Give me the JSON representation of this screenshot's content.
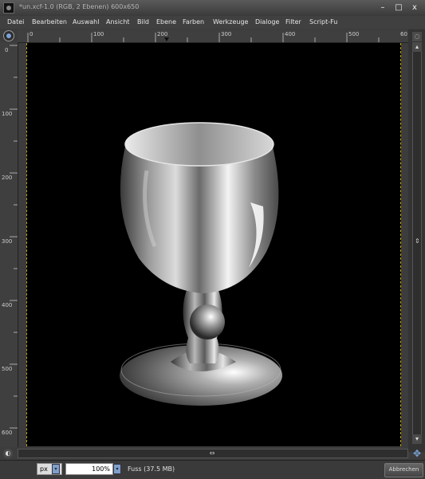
{
  "window": {
    "title": "*un.xcf-1.0 (RGB, 2 Ebenen) 600x650",
    "minimize": "–",
    "maximize": "□",
    "close": "x"
  },
  "menu": [
    "Datei",
    "Bearbeiten",
    "Auswahl",
    "Ansicht",
    "Bild",
    "Ebene",
    "Farben",
    "Werkzeuge",
    "Dialoge",
    "Filter",
    "Script-Fu"
  ],
  "ruler_top": [
    "0",
    "100",
    "200",
    "300",
    "400",
    "500",
    "60"
  ],
  "ruler_left": [
    "0",
    "100",
    "200",
    "300",
    "400",
    "500",
    "600"
  ],
  "statusbar": {
    "unit": "px",
    "zoom": "100%",
    "status": "Fuss (37.5 MB)",
    "cancel": "Abbrechen"
  },
  "icons": {
    "nav": "navigation-icon",
    "canvas_subject": "goblet-icon",
    "nav_corner": "crosshair-icon"
  },
  "colors": {
    "canvas": "#000000",
    "guides": "#b9a100",
    "accent": "#7f9fc9"
  }
}
